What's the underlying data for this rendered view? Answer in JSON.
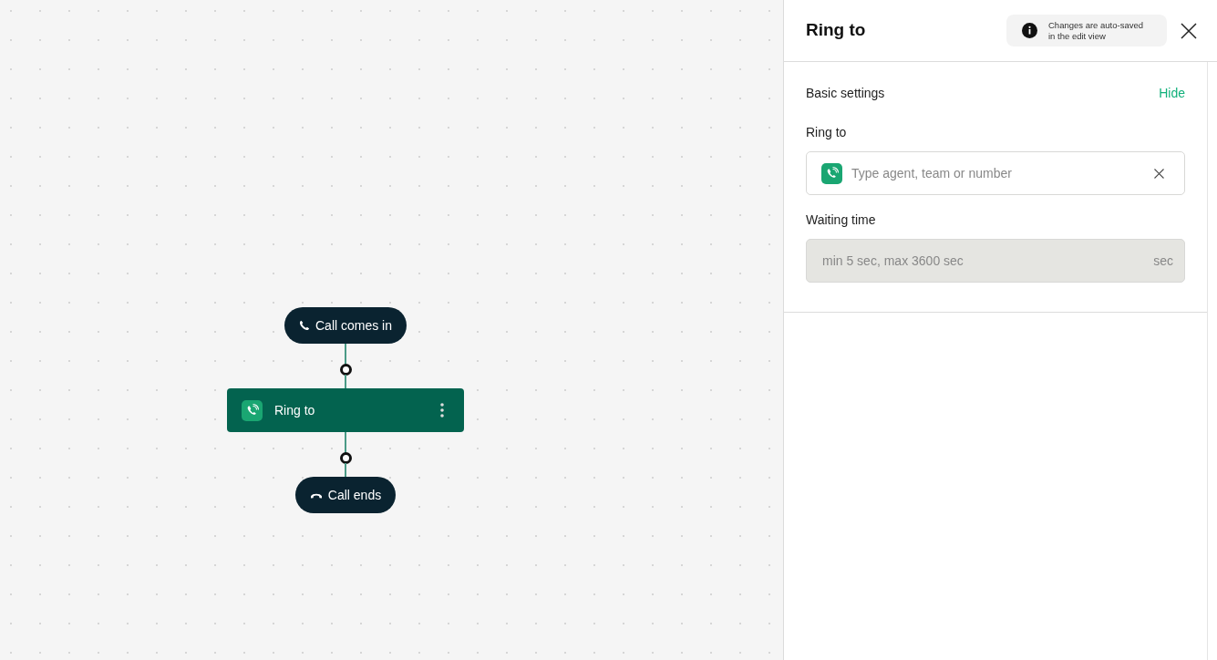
{
  "flow": {
    "nodes": [
      {
        "kind": "start",
        "label": "Call comes in"
      },
      {
        "kind": "action",
        "label": "Ring to"
      },
      {
        "kind": "end",
        "label": "Call ends"
      }
    ]
  },
  "panel": {
    "title": "Ring to",
    "notice": "Changes are auto-saved in the edit view",
    "section": {
      "title": "Basic settings",
      "toggle": "Hide",
      "fields": [
        {
          "kind": "recipient",
          "label": "Ring to",
          "placeholder": "Type agent, team or number",
          "disabled": false
        },
        {
          "kind": "duration",
          "label": "Waiting time",
          "placeholder": "min 5 sec, max 3600 sec",
          "unit": "sec",
          "disabled": true
        }
      ]
    }
  }
}
